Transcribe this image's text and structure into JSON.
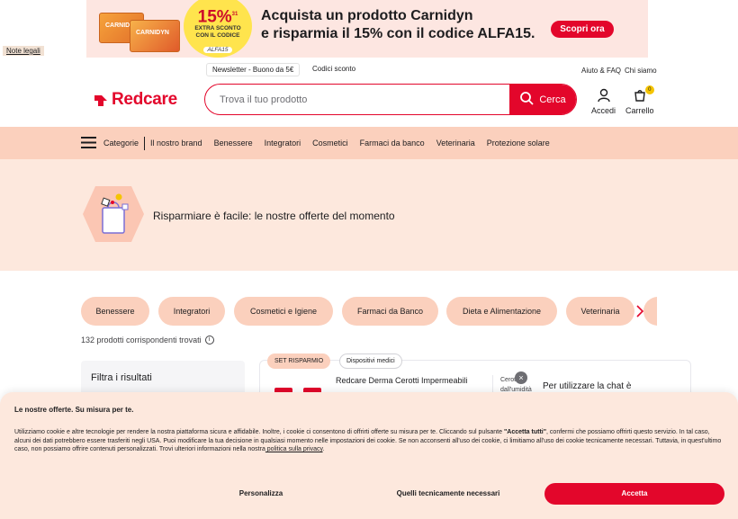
{
  "promo": {
    "product_name": "CARNIDYN",
    "badge_percent": "15%",
    "badge_sup": "31",
    "badge_line1": "EXTRA SCONTO",
    "badge_line2": "CON IL CODICE",
    "badge_code": "ALFA15",
    "headline_1": "Acquista un prodotto Carnidyn",
    "headline_2": "e risparmia il 15% con il codice ALFA15.",
    "cta": "Scopri ora"
  },
  "note_legali": "Note legali",
  "header": {
    "newsletter": "Newsletter - Buono da 5€",
    "codici_sconto": "Codici sconto",
    "aiuto_faq": "Aiuto & FAQ",
    "chi_siamo": "Chi siamo",
    "logo_text": "Redcare",
    "search_placeholder": "Trova il tuo prodotto",
    "search_button": "Cerca",
    "accedi": "Accedi",
    "carrello": "Carrello",
    "cart_count": "0"
  },
  "nav": {
    "categorie": "Categorie",
    "items": [
      "Il nostro brand",
      "Benessere",
      "Integratori",
      "Cosmetici",
      "Farmaci da banco",
      "Veterinaria",
      "Protezione solare"
    ]
  },
  "hero": {
    "title": "Risparmiare è facile: le nostre offerte del momento"
  },
  "chips": [
    "Benessere",
    "Integratori",
    "Cosmetici e Igiene",
    "Farmaci da Banco",
    "Dieta e Alimentazione",
    "Veterinaria"
  ],
  "results": {
    "count_text": "132 prodotti corrispondenti trovati",
    "info": "i"
  },
  "filter": {
    "title": "Filtra i risultati"
  },
  "product": {
    "tag1": "SET RISPARMIO",
    "tag2": "Dispositivi medici",
    "name": "Redcare Derma Cerotti Impermeabili",
    "side_1": "Cerotti a",
    "side_2": "dall'umidità"
  },
  "chat": {
    "close": "×",
    "text": "Per utilizzare la chat è"
  },
  "cookie": {
    "title": "Le nostre offerte. Su misura per te.",
    "body_1": "Utilizziamo cookie e altre tecnologie per rendere la nostra piattaforma sicura e affidabile. Inoltre, i cookie ci consentono di offrirti offerte su misura per te. Cliccando sul pulsante ",
    "body_bold": "\"Accetta tutti\"",
    "body_2": ", confermi che possiamo offrirti questo servizio. In tal caso, alcuni dei dati potrebbero essere trasferiti negli USA. Puoi modificare la tua decisione in qualsiasi momento nelle impostazioni dei cookie. Se non acconsenti all'uso dei cookie, ci limitiamo all'uso dei cookie tecnicamente necessari. Tuttavia, in quest'ultimo caso, non possiamo offrire contenuti personalizzati. Trovi ulteriori informazioni nella nostra",
    "privacy_link": " politica sulla privacy",
    "body_end": ".",
    "btn_personalizza": "Personalizza",
    "btn_necessari": "Quelli tecnicamente necessari",
    "btn_accetta": "Accetta"
  },
  "colors": {
    "brand_red": "#e3062b",
    "peach": "#fbd0bd",
    "light_peach": "#fde8dd"
  }
}
